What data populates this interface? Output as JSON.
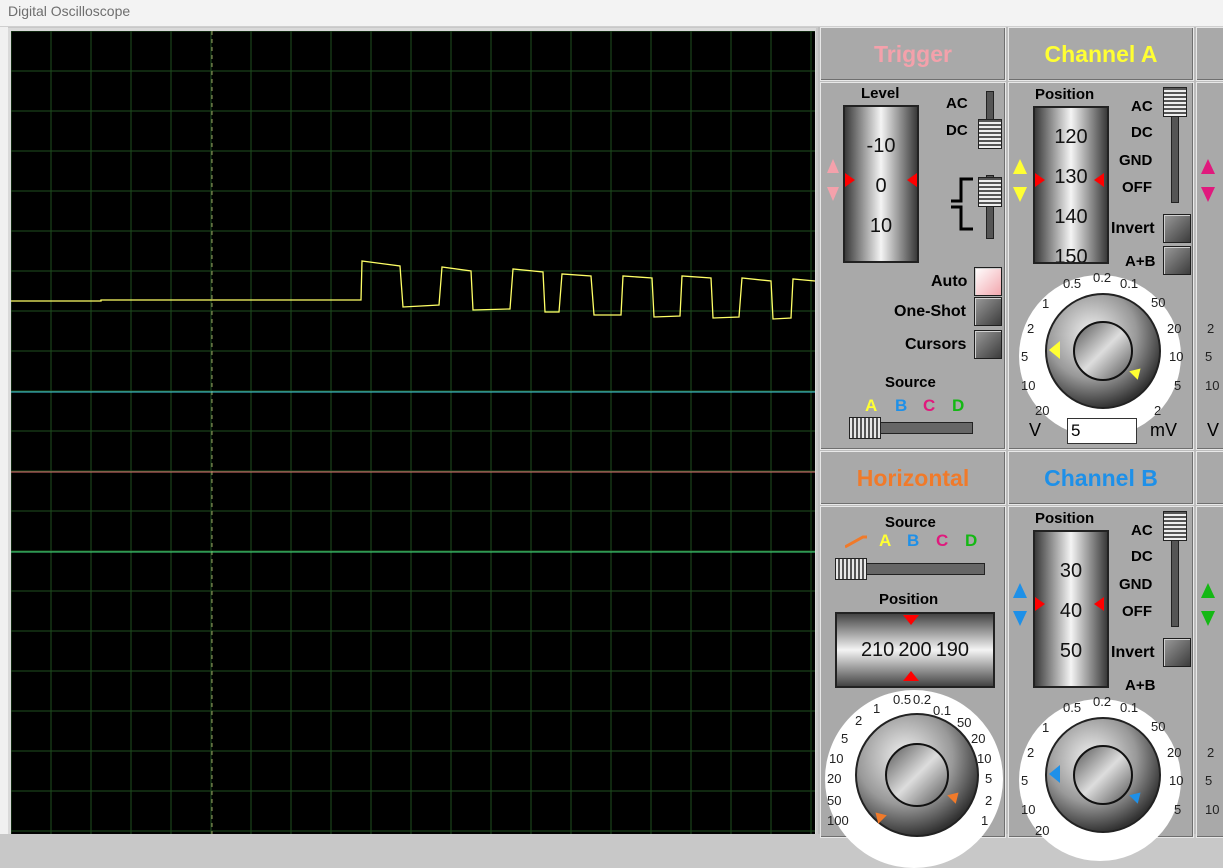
{
  "window": {
    "title": "Digital Oscilloscope"
  },
  "trigger": {
    "title": "Trigger",
    "level_label": "Level",
    "level_ticks": [
      "-10",
      "0",
      "10"
    ],
    "coupling": [
      "AC",
      "DC"
    ],
    "mode_buttons": [
      "Auto",
      "One-Shot",
      "Cursors"
    ],
    "source_label": "Source",
    "sources": [
      "A",
      "B",
      "C",
      "D"
    ]
  },
  "channel_a": {
    "title": "Channel A",
    "position_label": "Position",
    "position_ticks": [
      "120",
      "130",
      "140",
      "150"
    ],
    "coupling": [
      "AC",
      "DC",
      "GND",
      "OFF"
    ],
    "invert_label": "Invert",
    "aplusb_label": "A+B",
    "dial_labels": [
      "0.5",
      "0.2",
      "0.1",
      "1",
      "50",
      "2",
      "20",
      "5",
      "10",
      "10",
      "5",
      "20",
      "2"
    ],
    "unit_left": "V",
    "unit_right": "mV",
    "value": "5"
  },
  "horizontal": {
    "title": "Horizontal",
    "source_label": "Source",
    "sources": [
      "A",
      "B",
      "C",
      "D"
    ],
    "position_label": "Position",
    "position_ticks": [
      "210",
      "200",
      "190"
    ],
    "dial_labels": [
      "0.5",
      "0.2",
      "1",
      "0.1",
      "2",
      "50",
      "5",
      "20",
      "10",
      "10",
      "20",
      "5",
      "50",
      "2",
      "100",
      "1"
    ]
  },
  "channel_b": {
    "title": "Channel B",
    "position_label": "Position",
    "position_ticks": [
      "30",
      "40",
      "50"
    ],
    "coupling": [
      "AC",
      "DC",
      "GND",
      "OFF"
    ],
    "invert_label": "Invert",
    "aplusb_label": "A+B",
    "dial_labels": [
      "0.5",
      "0.2",
      "0.1",
      "1",
      "50",
      "2",
      "20",
      "5",
      "10",
      "10",
      "5",
      "20"
    ]
  },
  "partial_column": {
    "dial_labels": [
      "2",
      "5",
      "10",
      "V",
      "2",
      "5",
      "10"
    ]
  },
  "colors": {
    "trigger": "#f4a1ab",
    "channel_a": "#ffff33",
    "horizontal": "#f07a2a",
    "channel_b": "#1e90e8",
    "source_a": "#ffff33",
    "source_b": "#1e90e8",
    "source_c": "#e0197d",
    "source_d": "#14b814",
    "trace_a": "#ffff66",
    "trace_b": "#40d0e0",
    "trace_c": "#e07070",
    "trace_d": "#40e080",
    "grid": "#1f4f1f"
  }
}
